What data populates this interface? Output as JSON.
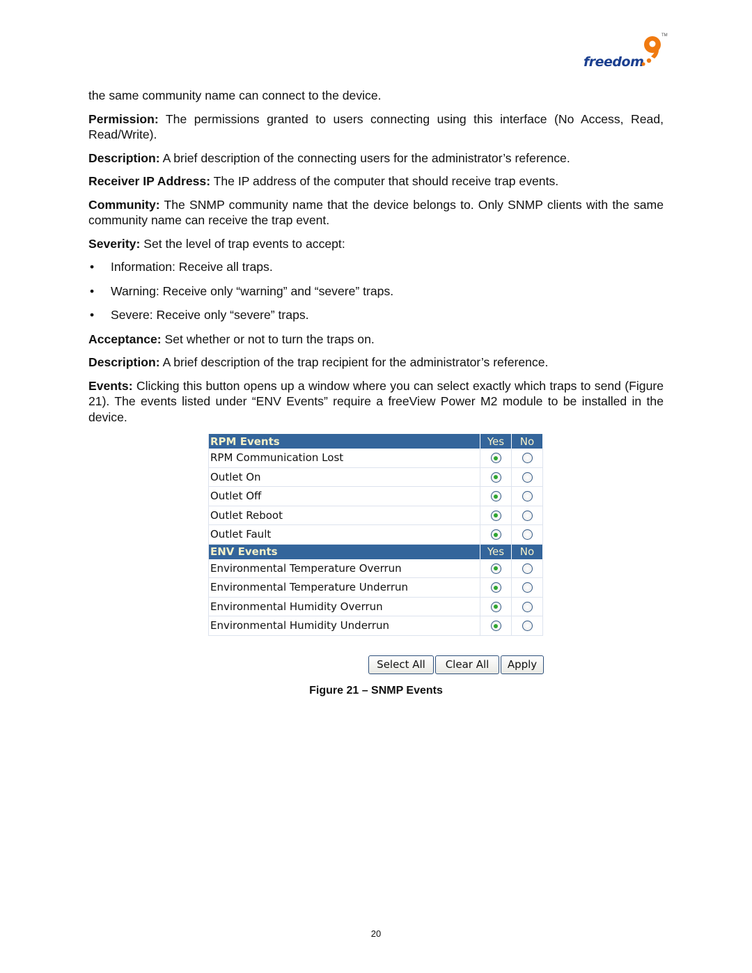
{
  "header": {
    "logo_text": "freedom",
    "logo_mark": "9",
    "logo_tm": "TM",
    "logo_colors": {
      "word": "#1b3f8f",
      "mark": "#f07a10"
    }
  },
  "body": {
    "continuation": "the same community name can connect to the device.",
    "paragraphs": [
      {
        "term": "Permission:",
        "text": " The permissions granted to users connecting using this interface (No Access, Read, Read/Write)."
      },
      {
        "term": "Description:",
        "text": " A brief description of the connecting users for the administrator’s reference."
      },
      {
        "term": "Receiver IP Address:",
        "text": " The IP address of the computer that should receive trap events."
      },
      {
        "term": "Community:",
        "text": " The SNMP community name that the device belongs to. Only SNMP clients with the same community name can receive the trap event."
      },
      {
        "term": "Severity:",
        "text": " Set the level of trap events to accept:"
      }
    ],
    "bullet_glyph": "•",
    "bullets": [
      "Information: Receive all traps.",
      "Warning: Receive only “warning” and “severe” traps.",
      "Severe: Receive only “severe” traps."
    ],
    "paragraphs2": [
      {
        "term": "Acceptance:",
        "text": " Set whether or not to turn the traps on."
      },
      {
        "term": "Description:",
        "text": " A brief description of the trap recipient for the administrator’s reference."
      },
      {
        "term": "Events:",
        "text": " Clicking this button opens up a window where you can select exactly which traps to send (Figure 21). The events listed under “ENV Events” require a freeView Power M2 module to be installed in the device."
      }
    ]
  },
  "figure": {
    "colors": {
      "header_bg": "#34659b",
      "header_text": "#f4f0c8",
      "radio_dot": "#2fa52f"
    },
    "sections": [
      {
        "title": "RPM Events",
        "yes": "Yes",
        "no": "No",
        "rows": [
          {
            "label": "RPM Communication Lost",
            "selected": "yes"
          },
          {
            "label": "Outlet On",
            "selected": "yes"
          },
          {
            "label": "Outlet Off",
            "selected": "yes"
          },
          {
            "label": "Outlet Reboot",
            "selected": "yes"
          },
          {
            "label": "Outlet Fault",
            "selected": "yes"
          }
        ]
      },
      {
        "title": "ENV Events",
        "yes": "Yes",
        "no": "No",
        "rows": [
          {
            "label": "Environmental Temperature Overrun",
            "selected": "yes"
          },
          {
            "label": "Environmental Temperature Underrun",
            "selected": "yes"
          },
          {
            "label": "Environmental Humidity Overrun",
            "selected": "yes"
          },
          {
            "label": "Environmental Humidity Underrun",
            "selected": "yes"
          }
        ]
      }
    ],
    "buttons": {
      "select_all": "Select All",
      "clear_all": "Clear All",
      "apply": "Apply"
    },
    "caption": "Figure 21 – SNMP Events"
  },
  "footer": {
    "page_number": "20"
  }
}
